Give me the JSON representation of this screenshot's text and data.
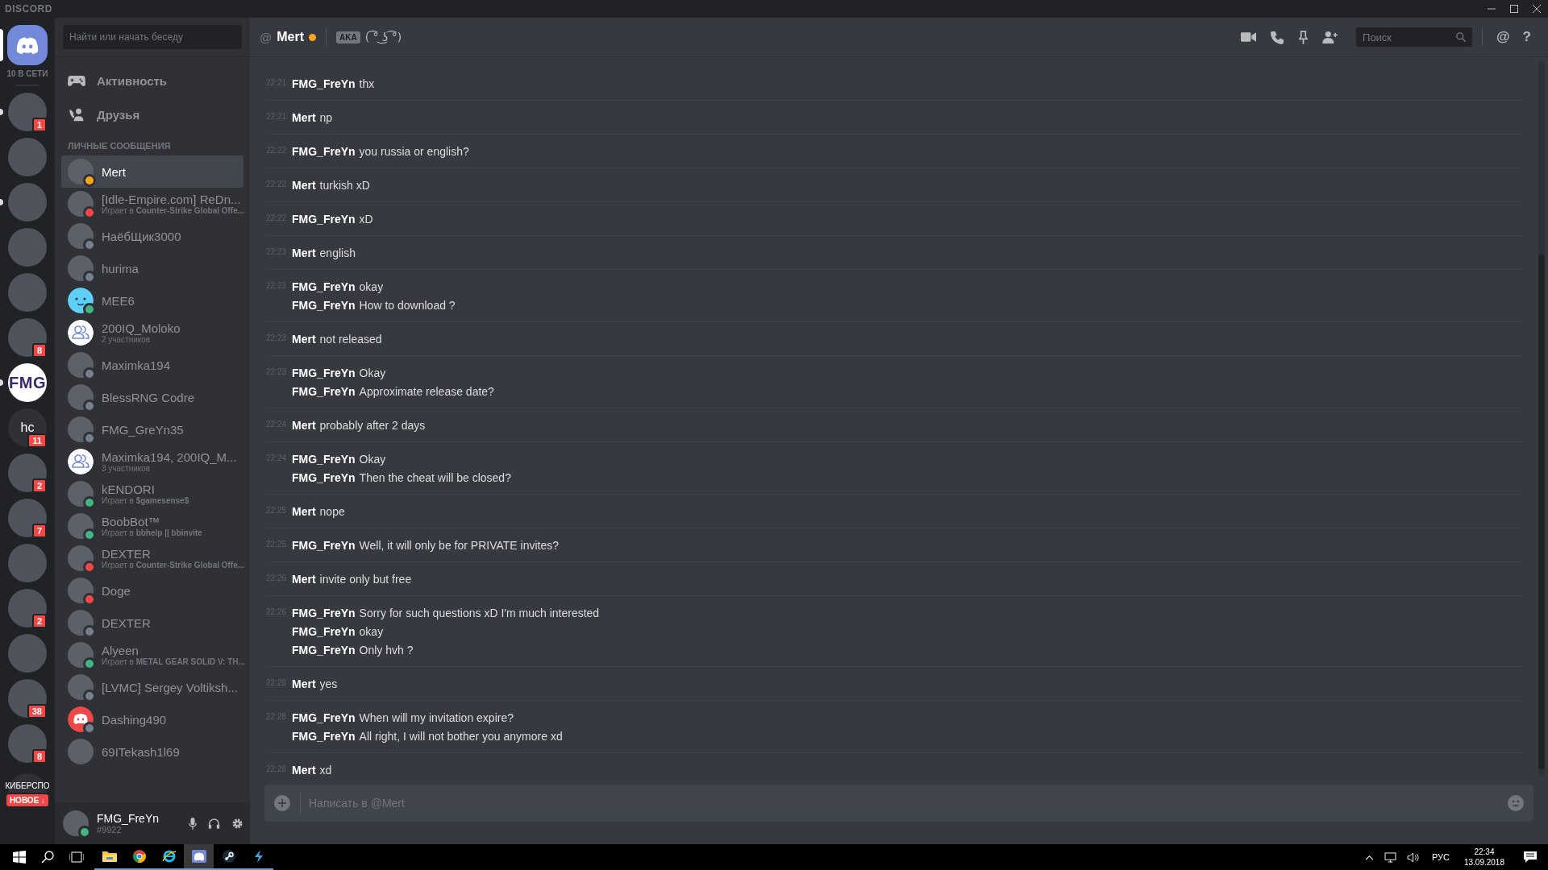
{
  "titlebar": {
    "logo": "DISCORD"
  },
  "home": {
    "selected": true,
    "online_count": "10 В СЕТИ"
  },
  "servers": [
    {
      "kind": "photo",
      "unread": true,
      "badge": "1"
    },
    {
      "kind": "photo",
      "unread": false
    },
    {
      "kind": "photo",
      "unread": true
    },
    {
      "kind": "photo",
      "unread": false
    },
    {
      "kind": "photo",
      "unread": false
    },
    {
      "kind": "photo",
      "unread": false,
      "badge": "8"
    },
    {
      "kind": "logo",
      "unread": true,
      "label": "FMG"
    },
    {
      "kind": "text",
      "unread": false,
      "label": "hc",
      "badge": "11"
    },
    {
      "kind": "photo",
      "unread": false,
      "badge": "2"
    },
    {
      "kind": "photo",
      "unread": false,
      "badge": "7"
    },
    {
      "kind": "photo",
      "unread": false
    },
    {
      "kind": "photo",
      "unread": false,
      "badge": "2"
    },
    {
      "kind": "photo",
      "unread": false
    },
    {
      "kind": "photo",
      "unread": false,
      "badge": "38"
    },
    {
      "kind": "photo",
      "unread": false,
      "badge": "8"
    },
    {
      "kind": "text",
      "unread": false,
      "label": "КИБЕРСПО",
      "new_label": "НОВОЕ ↓"
    }
  ],
  "dm_sidebar": {
    "search_placeholder": "Найти или начать беседу",
    "nav": [
      {
        "kind": "activity",
        "label": "Активность"
      },
      {
        "kind": "friends",
        "label": "Друзья"
      }
    ],
    "section_title": "ЛИЧНЫЕ СООБЩЕНИЯ",
    "items": [
      {
        "name": "Mert",
        "kind": "photo",
        "color": "#faa61a",
        "selected": true
      },
      {
        "name": "[Idle-Empire.com] ReDn...",
        "kind": "photo",
        "color": "#f04747",
        "selected": false,
        "subtitle": "Играет в **Counter-Strike Global Offe...**"
      },
      {
        "name": "НаёбЩик3000",
        "kind": "photo",
        "color": "#747f8d",
        "selected": false
      },
      {
        "name": "hurima",
        "kind": "photo",
        "color": "#747f8d",
        "selected": false
      },
      {
        "name": "MEE6",
        "kind": "bot-face",
        "color": "#43b581",
        "selected": false
      },
      {
        "name": "200IQ_Moloko",
        "kind": "group",
        "selected": false,
        "subtitle": "2 участников"
      },
      {
        "name": "Maximka194",
        "kind": "photo",
        "color": "#747f8d",
        "selected": false
      },
      {
        "name": "BlessRNG Codre",
        "kind": "photo",
        "color": "#747f8d",
        "selected": false
      },
      {
        "name": "FMG_GreYn35",
        "kind": "photo",
        "color": "#747f8d",
        "selected": false
      },
      {
        "name": "Maximka194, 200IQ_M...",
        "kind": "group",
        "selected": false,
        "subtitle": "3 участников"
      },
      {
        "name": "kENDORI",
        "kind": "photo",
        "color": "#43b581",
        "selected": false,
        "subtitle": "Играет в **$gamesense$**"
      },
      {
        "name": "BoobBot™",
        "kind": "photo",
        "color": "#43b581",
        "selected": false,
        "subtitle": "Играет в **bbhelp || bbinvite**"
      },
      {
        "name": "DEXTER",
        "kind": "photo",
        "color": "#f04747",
        "selected": false,
        "subtitle": "Играет в **Counter-Strike Global Offe...**"
      },
      {
        "name": "Doge",
        "kind": "photo",
        "color": "#f04747",
        "selected": false
      },
      {
        "name": "DEXTER",
        "kind": "photo",
        "color": "#747f8d",
        "selected": false
      },
      {
        "name": "Alyeen",
        "kind": "photo",
        "color": "#43b581",
        "selected": false,
        "subtitle": "Играет в **METAL GEAR SOLID V: TH...**"
      },
      {
        "name": "[LVMC] Sergey Voltiksh...",
        "kind": "photo",
        "color": "#747f8d",
        "selected": false
      },
      {
        "name": "Dashing490",
        "kind": "discord",
        "color": "#747f8d",
        "selected": false
      },
      {
        "name": "69ITekash1l69",
        "kind": "photo",
        "selected": false
      }
    ],
    "user": {
      "name": "FMG_FreYn",
      "tag": "#9922",
      "color": "#43b581"
    }
  },
  "header": {
    "at_glyph": "@",
    "name": "Mert",
    "color": "#faa61a",
    "aka": "AKA",
    "nickname": "( ͡° ͜ʖ ͡°)",
    "search_placeholder": "Поиск",
    "mentions_glyph": "@",
    "help_glyph": "?"
  },
  "messages": [
    {
      "time": "22:21",
      "lines": [
        {
          "author": "FMG_FreYn",
          "text": "thx"
        }
      ]
    },
    {
      "time": "22:21",
      "lines": [
        {
          "author": "Mert",
          "text": "np"
        }
      ]
    },
    {
      "time": "22:22",
      "lines": [
        {
          "author": "FMG_FreYn",
          "text": "you russia or english?"
        }
      ]
    },
    {
      "time": "22:22",
      "lines": [
        {
          "author": "Mert",
          "text": "turkish xD"
        }
      ]
    },
    {
      "time": "22:22",
      "lines": [
        {
          "author": "FMG_FreYn",
          "text": "xD"
        }
      ]
    },
    {
      "time": "22:23",
      "lines": [
        {
          "author": "Mert",
          "text": "english"
        }
      ]
    },
    {
      "time": "22:23",
      "lines": [
        {
          "author": "FMG_FreYn",
          "text": "okay"
        },
        {
          "author": "FMG_FreYn",
          "text": "How to download ?"
        }
      ]
    },
    {
      "time": "22:23",
      "lines": [
        {
          "author": "Mert",
          "text": "not released"
        }
      ]
    },
    {
      "time": "22:23",
      "lines": [
        {
          "author": "FMG_FreYn",
          "text": "Okay"
        },
        {
          "author": "FMG_FreYn",
          "text": "Approximate release date?"
        }
      ]
    },
    {
      "time": "22:24",
      "lines": [
        {
          "author": "Mert",
          "text": "probably after 2 days"
        }
      ]
    },
    {
      "time": "22:24",
      "lines": [
        {
          "author": "FMG_FreYn",
          "text": "Okay"
        },
        {
          "author": "FMG_FreYn",
          "text": "Then the cheat will be closed?"
        }
      ]
    },
    {
      "time": "22:25",
      "lines": [
        {
          "author": "Mert",
          "text": "nope"
        }
      ]
    },
    {
      "time": "22:25",
      "lines": [
        {
          "author": "FMG_FreYn",
          "text": "Well, it will only be for PRIVATE invites?"
        }
      ]
    },
    {
      "time": "22:26",
      "lines": [
        {
          "author": "Mert",
          "text": "invite only but free"
        }
      ]
    },
    {
      "time": "22:26",
      "lines": [
        {
          "author": "FMG_FreYn",
          "text": "Sorry for such questions xD I'm much interested"
        },
        {
          "author": "FMG_FreYn",
          "text": "okay"
        },
        {
          "author": "FMG_FreYn",
          "text": "Only hvh ?"
        }
      ]
    },
    {
      "time": "22:28",
      "lines": [
        {
          "author": "Mert",
          "text": "yes"
        }
      ]
    },
    {
      "time": "22:28",
      "lines": [
        {
          "author": "FMG_FreYn",
          "text": "When will my invitation expire?"
        },
        {
          "author": "FMG_FreYn",
          "text": "All right, I will not bother you anymore xd"
        }
      ]
    },
    {
      "time": "22:28",
      "lines": [
        {
          "author": "Mert",
          "text": "xd"
        }
      ]
    }
  ],
  "composer": {
    "placeholder": "Написать в @Mert"
  },
  "taskbar": {
    "apps": [
      {
        "kind": "folder",
        "selected": false
      },
      {
        "kind": "chrome",
        "selected": false
      },
      {
        "kind": "ie",
        "selected": false
      },
      {
        "kind": "discord",
        "selected": true
      },
      {
        "kind": "steam",
        "selected": false
      },
      {
        "kind": "bolt",
        "selected": false
      }
    ],
    "language": "РУС",
    "time": "22:34",
    "date": "13.09.2018"
  }
}
